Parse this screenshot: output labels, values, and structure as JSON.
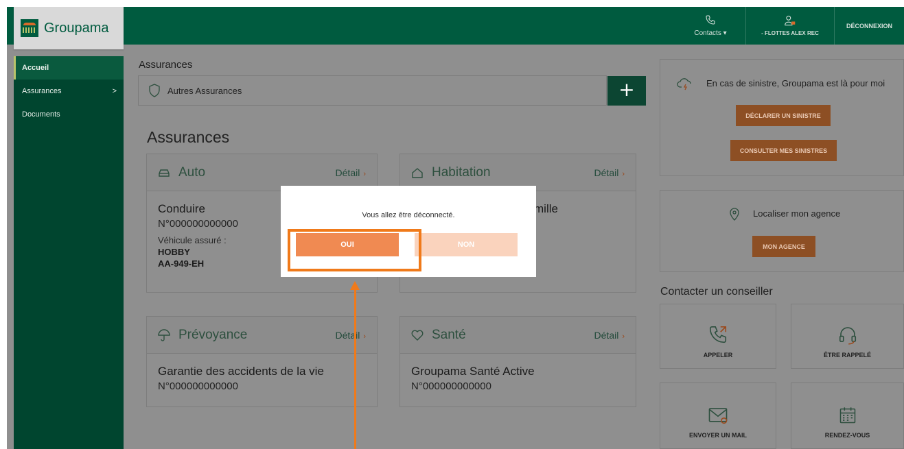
{
  "header": {
    "brand": "Groupama",
    "contacts_label": "Contacts ▾",
    "user_label": "- FLOTTES ALEX REC",
    "logout_label": "DÉCONNEXION"
  },
  "sidebar": {
    "items": [
      {
        "label": "Accueil"
      },
      {
        "label": "Assurances",
        "chevron": ">"
      },
      {
        "label": "Documents"
      }
    ]
  },
  "main": {
    "breadcrumb_title": "Assurances",
    "autres_label": "Autres Assurances",
    "plus_label": "+",
    "section_title": "Assurances",
    "cards": {
      "auto": {
        "title": "Auto",
        "detail": "Détail",
        "item_title": "Conduire",
        "item_number": "N°000000000000",
        "vehicle_label": "Véhicule assuré :",
        "vehicle_name": "HOBBY",
        "vehicle_plate": "AA-949-EH"
      },
      "habitation": {
        "title": "Habitation",
        "detail": "Détail",
        "item_title_visible": "mille"
      },
      "prevoyance": {
        "title": "Prévoyance",
        "detail": "Détail",
        "item_title": "Garantie des accidents de la vie",
        "item_number": "N°000000000000"
      },
      "sante": {
        "title": "Santé",
        "detail": "Détail",
        "item_title": "Groupama Santé Active",
        "item_number": "N°000000000000"
      }
    }
  },
  "right": {
    "sinistre_text": "En cas de sinistre, Groupama est là pour moi",
    "declarer_label": "DÉCLARER UN SINISTRE",
    "consulter_label": "CONSULTER MES SINISTRES",
    "agence_text": "Localiser mon agence",
    "agence_btn": "MON AGENCE",
    "contact_title": "Contacter un conseiller",
    "tiles": {
      "appeler": "APPELER",
      "rappele": "ÊTRE RAPPELÉ",
      "mail": "ENVOYER UN MAIL",
      "rdv": "RENDEZ-VOUS"
    }
  },
  "modal": {
    "message": "Vous allez être déconnecté.",
    "yes_label": "OUI",
    "no_label": "NON"
  },
  "colors": {
    "brand_green": "#005b3f",
    "accent_orange": "#f08a52",
    "annotation_orange": "#f07a1a"
  }
}
